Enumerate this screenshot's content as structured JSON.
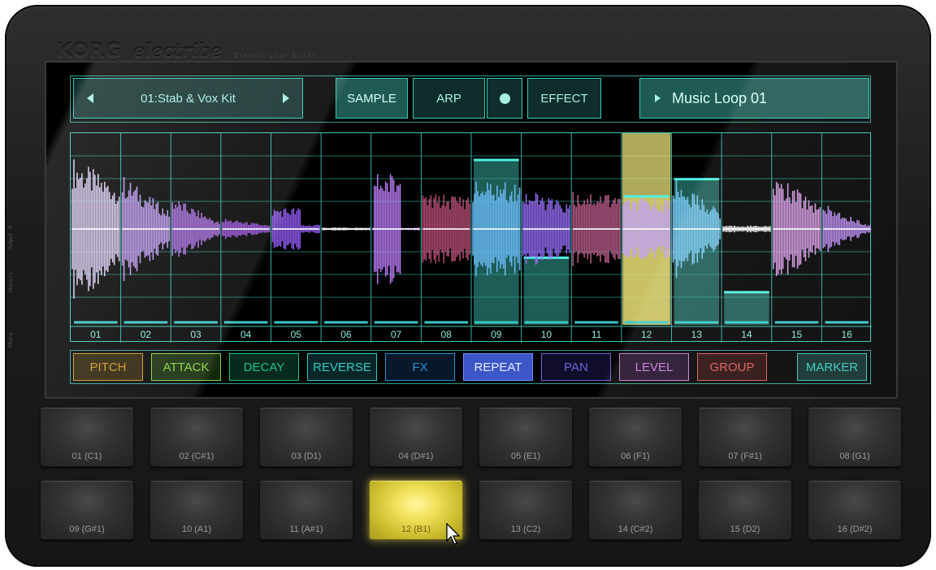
{
  "brand": {
    "logo": "KORG",
    "model": "electribe",
    "tagline": "Dynamic Loop Slicer"
  },
  "side_labels": [
    "R",
    "Output",
    "Mono / L",
    "Phone"
  ],
  "top_bar": {
    "kit": {
      "label": "01:Stab & Vox Kit",
      "prev_icon": "triangle-left-icon",
      "next_icon": "triangle-right-icon"
    },
    "sample_label": "SAMPLE",
    "arp_label": "ARP",
    "arp_toggle_icon": "dot-icon",
    "effect_label": "EFFECT",
    "loop": {
      "label": "Music Loop 01",
      "icon": "triangle-right-icon"
    }
  },
  "slices": {
    "labels": [
      "01",
      "02",
      "03",
      "04",
      "05",
      "06",
      "07",
      "08",
      "09",
      "10",
      "11",
      "12",
      "13",
      "14",
      "15",
      "16"
    ],
    "selected": "12",
    "levels": [
      0.0,
      0.0,
      0.0,
      0.0,
      0.0,
      0.0,
      0.0,
      0.0,
      0.86,
      0.35,
      0.0,
      0.67,
      0.76,
      0.17,
      0.0,
      0.0
    ]
  },
  "params": [
    {
      "label": "PITCH",
      "color": "#c9951f",
      "bg": "#2a1e05",
      "active": false
    },
    {
      "label": "ATTACK",
      "color": "#7fd23a",
      "bg": "#132a08",
      "active": false
    },
    {
      "label": "DECAY",
      "color": "#1fc28a",
      "bg": "#062a1d",
      "active": false
    },
    {
      "label": "REVERSE",
      "color": "#37c8c6",
      "bg": "#062628",
      "active": false
    },
    {
      "label": "FX",
      "color": "#2a8fd8",
      "bg": "#06182a",
      "active": false
    },
    {
      "label": "REPEAT",
      "color": "#6f8cff",
      "bg": "#3c56c8",
      "active": true
    },
    {
      "label": "PAN",
      "color": "#6a66d8",
      "bg": "#0f0d2a",
      "active": false
    },
    {
      "label": "LEVEL",
      "color": "#c77ad8",
      "bg": "#22102a",
      "active": false
    },
    {
      "label": "GROUP",
      "color": "#d85a5a",
      "bg": "#2a0d0d",
      "active": false
    },
    {
      "label": "MARKER",
      "color": "#37c8b6",
      "bg": "#0f2e2b",
      "active": false
    }
  ],
  "pads": [
    "01 (C1)",
    "02 (C#1)",
    "03 (D1)",
    "04 (D#1)",
    "05 (E1)",
    "06 (F1)",
    "07 (F#1)",
    "08 (G1)",
    "09 (G#1)",
    "10 (A1)",
    "11 (A#1)",
    "12 (B1)",
    "13 (C2)",
    "14 (C#2)",
    "15 (D2)",
    "16 (D#2)"
  ],
  "active_pad": "12 (B1)",
  "colors": {
    "accent": "#37c8b6",
    "selected_slice": "#e8e27a",
    "active_pad": "#f0e25a"
  }
}
